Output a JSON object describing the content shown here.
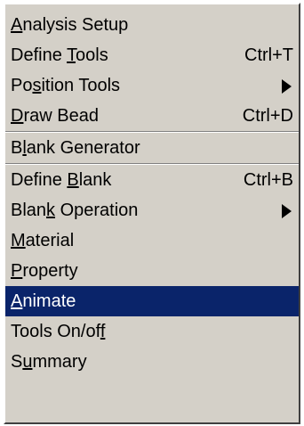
{
  "colors": {
    "menu_background": "#d4d0c8",
    "selected_background": "#0a246a",
    "selected_text": "#ffffff",
    "text": "#000000"
  },
  "menu": {
    "items": [
      {
        "label": "Analysis Setup",
        "mnemonic_index": 0,
        "shortcut": "",
        "submenu": false,
        "selected": false,
        "separator_after": false
      },
      {
        "label": "Define Tools",
        "mnemonic_index": 7,
        "shortcut": "Ctrl+T",
        "submenu": false,
        "selected": false,
        "separator_after": false
      },
      {
        "label": "Position Tools",
        "mnemonic_index": 2,
        "shortcut": "",
        "submenu": true,
        "submenu_icon": "triangle-right-icon",
        "selected": false,
        "separator_after": false
      },
      {
        "label": "Draw Bead",
        "mnemonic_index": 0,
        "shortcut": "Ctrl+D",
        "submenu": false,
        "selected": false,
        "separator_after": true
      },
      {
        "label": "Blank Generator",
        "mnemonic_index": 1,
        "shortcut": "",
        "submenu": false,
        "selected": false,
        "separator_after": true
      },
      {
        "label": "Define Blank",
        "mnemonic_index": 7,
        "shortcut": "Ctrl+B",
        "submenu": false,
        "selected": false,
        "separator_after": false
      },
      {
        "label": "Blank Operation",
        "mnemonic_index": 4,
        "shortcut": "",
        "submenu": true,
        "submenu_icon": "triangle-right-icon",
        "selected": false,
        "separator_after": false
      },
      {
        "label": "Material",
        "mnemonic_index": 0,
        "shortcut": "",
        "submenu": false,
        "selected": false,
        "separator_after": false
      },
      {
        "label": "Property",
        "mnemonic_index": 0,
        "shortcut": "",
        "submenu": false,
        "selected": false,
        "separator_after": false
      },
      {
        "label": "Animate",
        "mnemonic_index": 0,
        "shortcut": "",
        "submenu": false,
        "selected": true,
        "separator_after": false
      },
      {
        "label": "Tools On/off",
        "mnemonic_index": 11,
        "shortcut": "",
        "submenu": false,
        "selected": false,
        "separator_after": false
      },
      {
        "label": "Summary",
        "mnemonic_index": 1,
        "shortcut": "",
        "submenu": false,
        "selected": false,
        "separator_after": false
      }
    ]
  }
}
